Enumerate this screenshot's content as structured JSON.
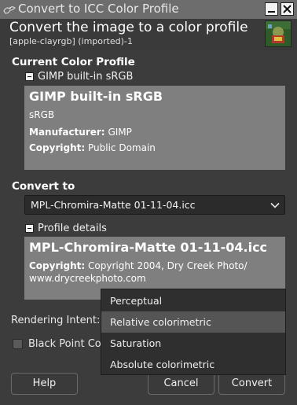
{
  "window": {
    "title": "Convert to ICC Color Profile",
    "minimize_label": "",
    "close_label": ""
  },
  "header": {
    "title": "Convert the image to a color profile",
    "subtitle": "[apple-clayrgb] (imported)-1"
  },
  "current": {
    "section_title": "Current Color Profile",
    "expander_label": "GIMP built-in sRGB",
    "profile_name": "GIMP built-in sRGB",
    "description": "sRGB",
    "manufacturer_label": "Manufacturer:",
    "manufacturer_value": "GIMP",
    "copyright_label": "Copyright:",
    "copyright_value": "Public Domain"
  },
  "convert": {
    "section_title": "Convert to",
    "selected_profile": "MPL-Chromira-Matte 01-11-04.icc",
    "expander_label": "Profile details",
    "profile_name": "MPL-Chromira-Matte 01-11-04.icc",
    "copyright_label": "Copyright:",
    "copyright_value_line1": "Copyright 2004, Dry Creek Photo/",
    "copyright_value_line2": "www.drycreekphoto.com"
  },
  "rendering": {
    "label": "Rendering Intent:",
    "options": [
      "Perceptual",
      "Relative colorimetric",
      "Saturation",
      "Absolute colorimetric"
    ],
    "highlighted": "Relative colorimetric"
  },
  "black_point": {
    "label": "Black Point Compensation",
    "checked": false
  },
  "buttons": {
    "help": "Help",
    "cancel": "Cancel",
    "convert": "Convert"
  },
  "colors": {
    "titlebar": "#6d6d6d",
    "dialog_bg": "#3c3c3c",
    "profile_box": "#7f7f7f",
    "menu_highlight": "#555555"
  },
  "icons": {
    "app": "gimp-wilber-icon",
    "thumbnail": "image-thumbnail",
    "combo_arrow": "chevron-down-icon"
  }
}
